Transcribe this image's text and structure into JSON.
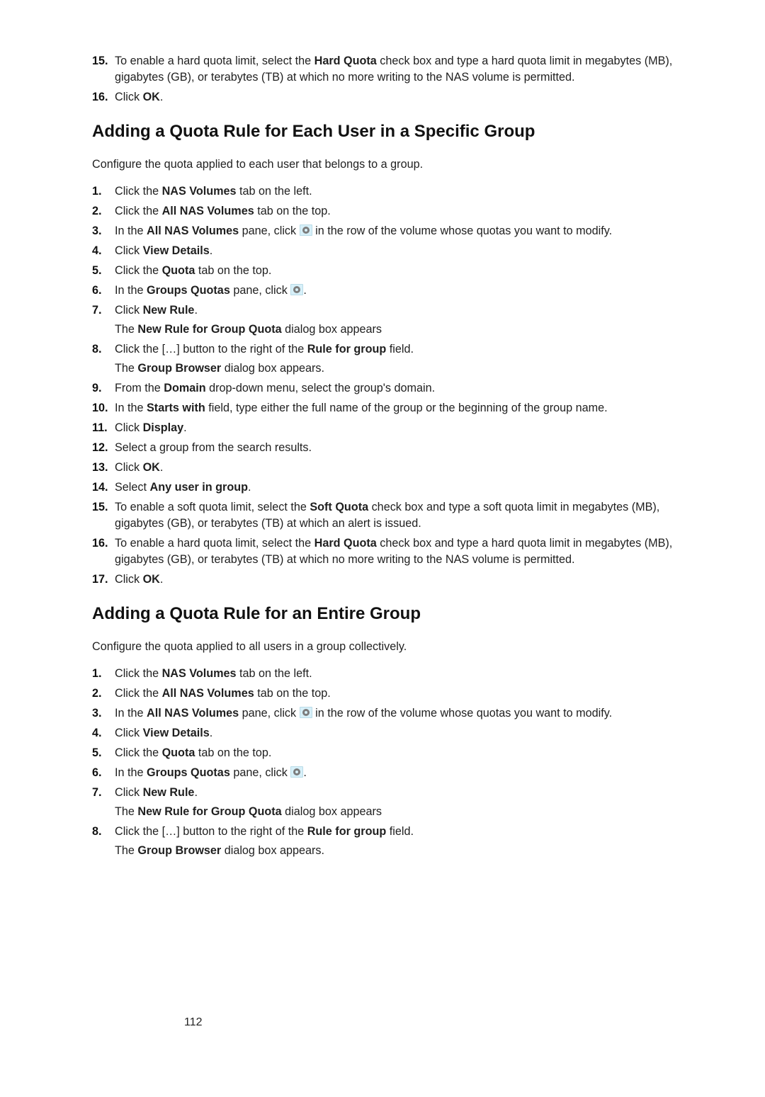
{
  "top_steps": [
    {
      "num": "15.",
      "text": [
        "To enable a hard quota limit, select the ",
        "Hard Quota",
        " check box and type a hard quota limit in megabytes (MB), gigabytes (GB), or terabytes (TB) at which no more writing to the NAS volume is permitted."
      ]
    },
    {
      "num": "16.",
      "text": [
        "Click ",
        "OK",
        "."
      ]
    }
  ],
  "section1": {
    "title": "Adding a Quota Rule for Each User in a Specific Group",
    "intro": "Configure the quota applied to each user that belongs to a group.",
    "steps": [
      {
        "num": "1.",
        "text": [
          "Click the ",
          "NAS Volumes",
          " tab on the left."
        ]
      },
      {
        "num": "2.",
        "text": [
          "Click the ",
          "All NAS Volumes",
          " tab on the top."
        ]
      },
      {
        "num": "3.",
        "icon": true,
        "pre": [
          "In the ",
          "All NAS Volumes",
          " pane, click "
        ],
        "post": [
          " in the row of the volume whose quotas you want to modify."
        ]
      },
      {
        "num": "4.",
        "text": [
          "Click ",
          "View Details",
          "."
        ]
      },
      {
        "num": "5.",
        "text": [
          "Click the ",
          "Quota",
          " tab on the top."
        ]
      },
      {
        "num": "6.",
        "icon": true,
        "pre": [
          "In the ",
          "Groups Quotas",
          " pane, click "
        ],
        "post": [
          "."
        ]
      },
      {
        "num": "7.",
        "text": [
          "Click ",
          "New Rule",
          "."
        ],
        "sub": [
          "The ",
          "New Rule for Group Quota",
          " dialog box appears"
        ]
      },
      {
        "num": "8.",
        "text": [
          "Click the […] button to the right of the ",
          "Rule for group",
          " field."
        ],
        "sub": [
          "The ",
          "Group Browser",
          " dialog box appears."
        ]
      },
      {
        "num": "9.",
        "text": [
          "From the ",
          "Domain",
          " drop‑down menu, select the group's domain."
        ]
      },
      {
        "num": "10.",
        "text": [
          "In the ",
          "Starts with",
          " field, type either the full name of the group or the beginning of the group name."
        ]
      },
      {
        "num": "11.",
        "text": [
          "Click ",
          "Display",
          "."
        ]
      },
      {
        "num": "12.",
        "text": [
          "Select a group from the search results."
        ]
      },
      {
        "num": "13.",
        "text": [
          "Click ",
          "OK",
          "."
        ]
      },
      {
        "num": "14.",
        "text": [
          "Select ",
          "Any user in group",
          "."
        ]
      },
      {
        "num": "15.",
        "text": [
          "To enable a soft quota limit, select the ",
          "Soft Quota",
          " check box and type a soft quota limit in megabytes (MB), gigabytes (GB), or terabytes (TB) at which an alert is issued."
        ]
      },
      {
        "num": "16.",
        "text": [
          "To enable a hard quota limit, select the ",
          "Hard Quota",
          " check box and type a hard quota limit in megabytes (MB), gigabytes (GB), or terabytes (TB) at which no more writing to the NAS volume is permitted."
        ]
      },
      {
        "num": "17.",
        "text": [
          "Click ",
          "OK",
          "."
        ]
      }
    ]
  },
  "section2": {
    "title": "Adding a Quota Rule for an Entire Group",
    "intro": "Configure the quota applied to all users in a group collectively.",
    "steps": [
      {
        "num": "1.",
        "text": [
          "Click the ",
          "NAS Volumes",
          " tab on the left."
        ]
      },
      {
        "num": "2.",
        "text": [
          "Click the ",
          "All NAS Volumes",
          " tab on the top."
        ]
      },
      {
        "num": "3.",
        "icon": true,
        "pre": [
          "In the ",
          "All NAS Volumes",
          " pane, click "
        ],
        "post": [
          " in the row of the volume whose quotas you want to modify."
        ]
      },
      {
        "num": "4.",
        "text": [
          "Click ",
          "View Details",
          "."
        ]
      },
      {
        "num": "5.",
        "text": [
          "Click the ",
          "Quota",
          " tab on the top."
        ]
      },
      {
        "num": "6.",
        "icon": true,
        "pre": [
          "In the ",
          "Groups Quotas",
          " pane, click "
        ],
        "post": [
          "."
        ]
      },
      {
        "num": "7.",
        "text": [
          "Click ",
          "New Rule",
          "."
        ],
        "sub": [
          "The ",
          "New Rule for Group Quota",
          " dialog box appears"
        ]
      },
      {
        "num": "8.",
        "text": [
          "Click the […] button to the right of the ",
          "Rule for group",
          " field."
        ],
        "sub": [
          "The ",
          "Group Browser",
          " dialog box appears."
        ]
      }
    ]
  },
  "page_number": "112"
}
